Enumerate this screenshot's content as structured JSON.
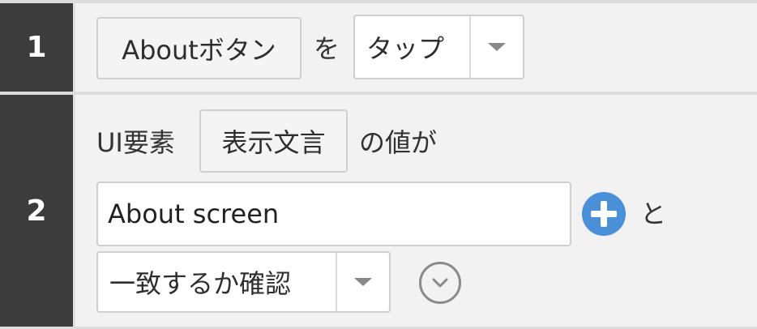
{
  "steps": [
    {
      "number": "1",
      "element_chip": "Aboutボタン",
      "particle": "を",
      "action_select": {
        "value": "タップ"
      }
    },
    {
      "number": "2",
      "prefix_text": "UI要素",
      "attribute_chip": "表示文言",
      "suffix_text": "の値が",
      "value_input": "About screen",
      "after_plus_text": "と",
      "comparison_select": {
        "value": "一致するか確認"
      }
    }
  ],
  "icons": {
    "add": "plus-circle-icon",
    "dropdown": "caret-down-icon",
    "expand": "chevron-down-circle-icon"
  },
  "colors": {
    "step_number_bg": "#3c3c3c",
    "add_icon": "#4a90d9"
  }
}
